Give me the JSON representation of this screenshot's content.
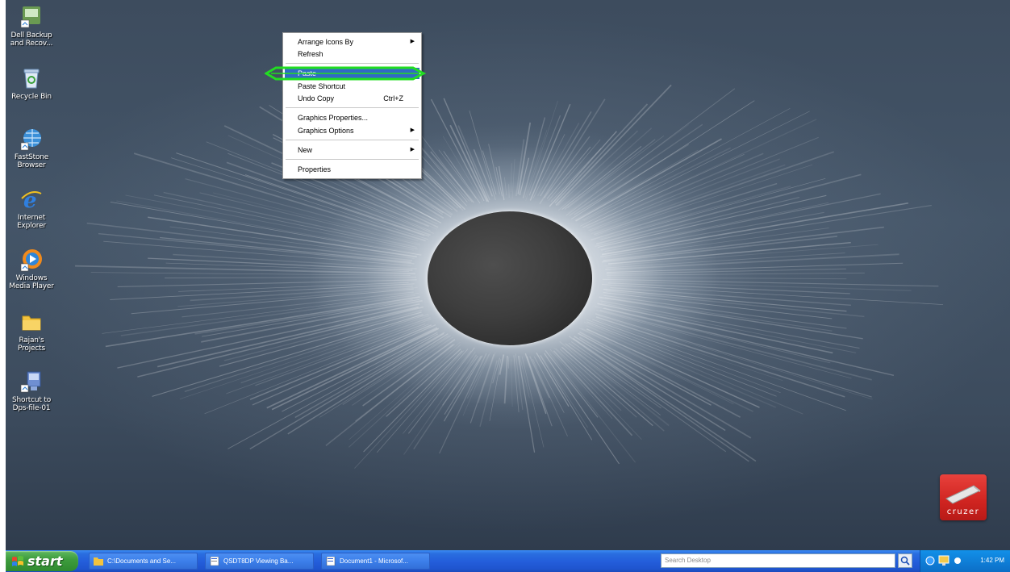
{
  "desktop_icons": [
    {
      "icon": "dell-backup-icon",
      "label_lines": [
        "Dell Backup",
        "and Recov..."
      ]
    },
    {
      "icon": "recycle-bin-icon",
      "label_lines": [
        "Recycle Bin"
      ]
    },
    {
      "icon": "faststone-browser-icon",
      "label_lines": [
        "FastStone",
        "Browser"
      ]
    },
    {
      "icon": "internet-explorer-icon",
      "label_lines": [
        "Internet",
        "Explorer"
      ]
    },
    {
      "icon": "windows-media-player-icon",
      "label_lines": [
        "Windows",
        "Media Player"
      ]
    },
    {
      "icon": "folder-icon",
      "label_lines": [
        "Rajan's",
        "Projects"
      ]
    },
    {
      "icon": "network-shortcut-icon",
      "label_lines": [
        "Shortcut to",
        "Dps-file-01"
      ]
    }
  ],
  "context_menu": {
    "items": [
      {
        "label": "Arrange Icons By",
        "submenu": true
      },
      {
        "label": "Refresh"
      },
      {
        "label": "Paste",
        "highlighted": true
      },
      {
        "label": "Paste Shortcut"
      },
      {
        "label": "Undo Copy",
        "shortcut": "Ctrl+Z"
      },
      {
        "label": "Graphics Properties..."
      },
      {
        "label": "Graphics Options",
        "submenu": true
      },
      {
        "label": "New",
        "submenu": true
      },
      {
        "label": "Properties"
      }
    ]
  },
  "cruzer_widget": {
    "label": "cruzer"
  },
  "taskbar": {
    "start_label": "start",
    "tasks": [
      {
        "icon": "folder-icon",
        "label": "C:\\Documents and Se..."
      },
      {
        "icon": "document-icon",
        "label": "QSDT8DP Viewing Ba..."
      },
      {
        "icon": "word-document-icon",
        "label": "Document1 - Microsof..."
      }
    ],
    "search_placeholder": "Search Desktop",
    "clock": "1:42 PM"
  },
  "colors": {
    "taskbar_blue": "#245edb",
    "start_green": "#3e9d3e",
    "menu_highlight": "#316ac5",
    "annotation_green": "#22dd22",
    "cruzer_red": "#cf2420"
  }
}
